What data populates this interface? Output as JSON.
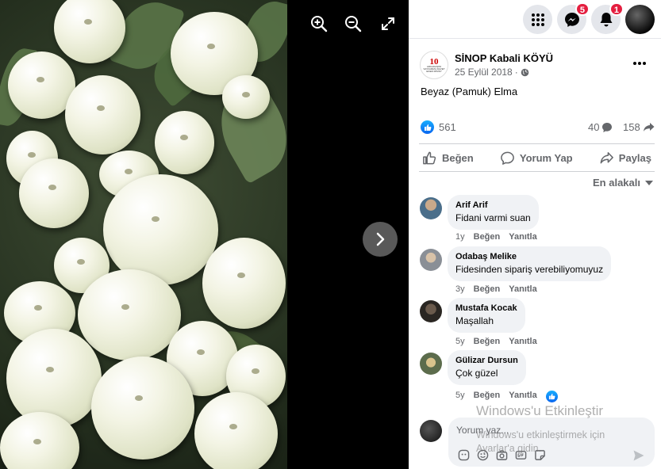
{
  "viewer": {
    "photo_alt": "Beyaz (Pamuk) Elma",
    "tools": [
      "zoom-in",
      "zoom-out",
      "fullscreen"
    ]
  },
  "topbar": {
    "messenger_badge": "5",
    "notifications_badge": "1"
  },
  "post": {
    "page_name": "SİNOP Kabali KÖYÜ",
    "page_avatar_number": "10",
    "page_avatar_text": "ARKADAŞINI SAYFAMIZA DAVET EDER MİSİN?",
    "date": "25 Eylül 2018",
    "date_separator": "·",
    "text": "Beyaz (Pamuk) Elma",
    "reactions_count": "561",
    "comments_count": "40",
    "shares_count": "158",
    "actions": {
      "like": "Beğen",
      "comment": "Yorum Yap",
      "share": "Paylaş"
    },
    "sort_label": "En alakalı"
  },
  "comments": [
    {
      "author": "Arif Arif",
      "text": "Fidani varmi suan",
      "age": "1y",
      "like": "Beğen",
      "reply": "Yanıtla"
    },
    {
      "author": "Odabaş Melike",
      "text": "Fidesinden sipariş verebiliyomuyuz",
      "age": "3y",
      "like": "Beğen",
      "reply": "Yanıtla"
    },
    {
      "author": "Mustafa Kocak",
      "text": "Maşallah",
      "age": "5y",
      "like": "Beğen",
      "reply": "Yanıtla"
    },
    {
      "author": "Gülizar Dursun",
      "text": "Çok güzel",
      "age": "5y",
      "like": "Beğen",
      "reply": "Yanıtla"
    }
  ],
  "composer": {
    "placeholder": "Yorum yaz..."
  },
  "watermark": {
    "title": "Windows'u Etkinleştir",
    "line1": "Windows'u etkinleştirmek için",
    "line2": "Ayarlar'a gidin."
  },
  "colors": {
    "accent": "#1877f2",
    "badge": "#e41e3f",
    "secondary_text": "#65676b",
    "bubble": "#f0f2f5"
  }
}
